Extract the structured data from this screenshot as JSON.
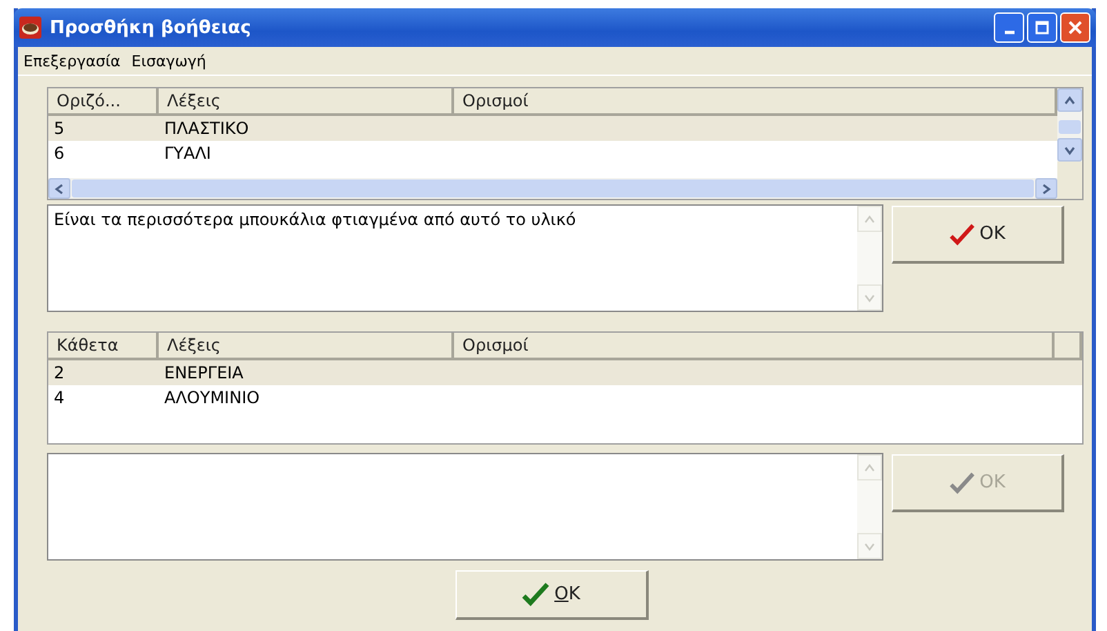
{
  "window": {
    "title": "Προσθήκη βοήθειας"
  },
  "menu": [
    "Επεξεργασία",
    "Εισαγωγή"
  ],
  "grid_top": {
    "columns": [
      "Οριζό...",
      "Λέξεις",
      "Ορισμοί"
    ],
    "rows": [
      {
        "cells": [
          "5",
          "ΠΛΑΣΤΙΚΟ",
          ""
        ],
        "selected": true
      },
      {
        "cells": [
          "6",
          "ΓΥΑΛΙ",
          ""
        ],
        "selected": false
      }
    ]
  },
  "definition_top": {
    "value": "Είναι τα περισσότερα μπουκάλια φτιαγμένα από αυτό το υλικό"
  },
  "ok_top": {
    "label": "OK",
    "disabled": false
  },
  "grid_bottom": {
    "columns": [
      "Κάθετα",
      "Λέξεις",
      "Ορισμοί"
    ],
    "rows": [
      {
        "cells": [
          "2",
          "ΕΝΕΡΓΕΙΑ",
          ""
        ],
        "selected": true
      },
      {
        "cells": [
          "4",
          "ΑΛΟΥΜΙΝΙΟ",
          ""
        ],
        "selected": false
      }
    ]
  },
  "ok_bottom": {
    "label": "OK",
    "disabled": true
  },
  "ok_main": {
    "label": "OK",
    "disabled": false
  }
}
